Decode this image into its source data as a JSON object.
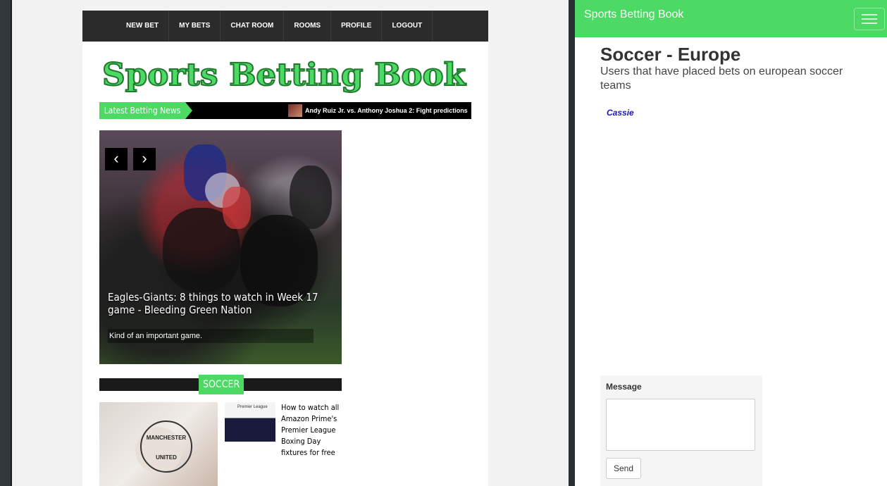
{
  "site": {
    "nav": [
      "NEW BET",
      "MY BETS",
      "CHAT ROOM",
      "ROOMS",
      "PROFILE",
      "LOGOUT"
    ],
    "logo_text": "Sports Betting Book",
    "news_label": "Latest Betting News",
    "news_ticker": "Andy Ruiz Jr. vs. Anthony Joshua 2: Fight predictions",
    "hero": {
      "prev": "‹",
      "next": "›",
      "title": "Eagles-Giants: 8 things to watch in Week 17 game - Bleeding Green Nation",
      "subtitle": "Kind of an important game."
    },
    "section_label": "SOCCER",
    "crest_top": "MANCHESTER",
    "crest_bottom": "UNITED",
    "pl_thumb_text": "Premier League",
    "article_link": "How to watch all Amazon Prime's Premier League Boxing Day fixtures for free"
  },
  "chat": {
    "brand": "Sports Betting Book",
    "room_title": "Soccer - Europe",
    "room_description": "Users that have placed bets on european soccer teams",
    "users": [
      "Cassie"
    ],
    "message_label": "Message",
    "message_value": "",
    "send_label": "Send"
  },
  "colors": {
    "accent": "#4cd964",
    "nav_bg": "#2b2b2b",
    "user_link": "#1a1aa6"
  }
}
